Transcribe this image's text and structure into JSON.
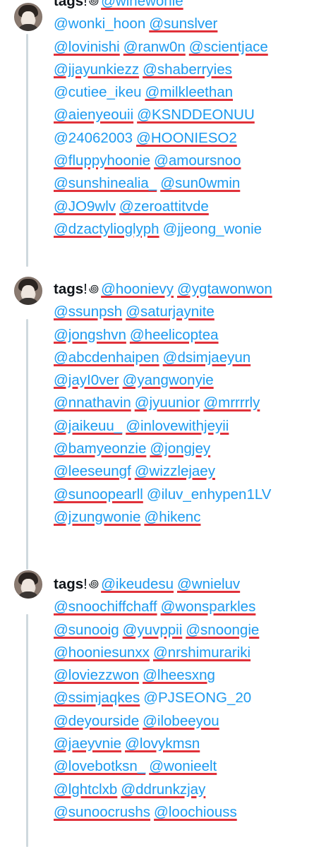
{
  "thread": [
    {
      "lead": "tags",
      "lead_excl": "!",
      "glyph": "꩜",
      "lines": [
        [
          {
            "text": "@winewonie",
            "u": true
          }
        ],
        [
          {
            "text": "@wonki_hoon",
            "u": false
          },
          {
            "text": "@sunslver",
            "u": true
          }
        ],
        [
          {
            "text": "@lovinishi",
            "u": true
          },
          {
            "text": "@ranw0n",
            "u": true
          },
          {
            "text": "@scientjace",
            "u": true
          }
        ],
        [
          {
            "text": "@jjayunkiezz",
            "u": true
          },
          {
            "text": "@shaberryies",
            "u": true
          }
        ],
        [
          {
            "text": "@cutiee_ikeu",
            "u": false
          },
          {
            "text": "@milkleethan",
            "u": true
          }
        ],
        [
          {
            "text": "@aienyeouii",
            "u": true
          },
          {
            "text": "@KSNDDEONUU",
            "u": true
          }
        ],
        [
          {
            "text": "@24062003",
            "u": false
          },
          {
            "text": "@HOONIESO2",
            "u": true
          }
        ],
        [
          {
            "text": "@fluppyhoonie",
            "u": true
          },
          {
            "text": "@amoursnoo",
            "u": true
          }
        ],
        [
          {
            "text": "@sunshinealia_",
            "u": true
          },
          {
            "text": "@sun0wmin",
            "u": true
          }
        ],
        [
          {
            "text": "@JO9wlv",
            "u": true
          },
          {
            "text": "@zeroattitvde",
            "u": true
          }
        ],
        [
          {
            "text": "@dzactylioglyph",
            "u": true
          },
          {
            "text": "@jjeong_wonie",
            "u": false
          }
        ]
      ]
    },
    {
      "lead": "tags",
      "lead_excl": "!",
      "glyph": "꩜",
      "lines": [
        [
          {
            "text": "@hoonievy",
            "u": true
          },
          {
            "text": "@ygtawonwon",
            "u": true
          }
        ],
        [
          {
            "text": "@ssunpsh",
            "u": true
          },
          {
            "text": "@saturjaynite",
            "u": true
          }
        ],
        [
          {
            "text": "@jongshvn",
            "u": true
          },
          {
            "text": "@heelicoptea",
            "u": true
          }
        ],
        [
          {
            "text": "@abcdenhaipen",
            "u": true
          },
          {
            "text": "@dsimjaeyun",
            "u": true
          }
        ],
        [
          {
            "text": "@jayI0ver",
            "u": true
          },
          {
            "text": "@yangwonyie",
            "u": true
          }
        ],
        [
          {
            "text": "@nnathavin",
            "u": true
          },
          {
            "text": "@jyuunior",
            "u": true
          },
          {
            "text": "@mrrrrly",
            "u": true
          }
        ],
        [
          {
            "text": "@jaikeuu_",
            "u": true
          },
          {
            "text": "@inlovewithjeyii",
            "u": true
          }
        ],
        [
          {
            "text": "@bamyeonzie",
            "u": true
          },
          {
            "text": "@jongjey",
            "u": true
          }
        ],
        [
          {
            "text": "@leeseungf",
            "u": true
          },
          {
            "text": "@wizzlejaey",
            "u": true
          }
        ],
        [
          {
            "text": "@sunoopearll",
            "u": true
          },
          {
            "text": "@iluv_enhypen1LV",
            "u": false
          }
        ],
        [
          {
            "text": "@jzungwonie",
            "u": true
          },
          {
            "text": "@hikenc",
            "u": true
          }
        ]
      ]
    },
    {
      "lead": "tags",
      "lead_excl": "!",
      "glyph": "꩜",
      "lines": [
        [
          {
            "text": "@ikeudesu",
            "u": true
          },
          {
            "text": "@wnieluv",
            "u": true
          }
        ],
        [
          {
            "text": "@snoochiffchaff",
            "u": true
          },
          {
            "text": "@wonsparkles",
            "u": true
          }
        ],
        [
          {
            "text": "@sunooig",
            "u": true
          },
          {
            "text": "@yuvppii",
            "u": true
          },
          {
            "text": "@snoongie",
            "u": true
          }
        ],
        [
          {
            "text": "@hooniesunxx",
            "u": true
          },
          {
            "text": "@nrshimurariki",
            "u": true
          }
        ],
        [
          {
            "text": "@loviezzwon",
            "u": true
          },
          {
            "text": "@lheesxng",
            "u": true
          }
        ],
        [
          {
            "text": "@ssimjaqkes",
            "u": true
          },
          {
            "text": "@PJSEONG_20",
            "u": false
          }
        ],
        [
          {
            "text": "@deyourside",
            "u": true
          },
          {
            "text": "@ilobeeyou",
            "u": true
          }
        ],
        [
          {
            "text": "@jaeyvnie",
            "u": true
          },
          {
            "text": "@lovykmsn",
            "u": true
          }
        ],
        [
          {
            "text": "@lovebotksn_",
            "u": true
          },
          {
            "text": "@wonieelt",
            "u": true
          }
        ],
        [
          {
            "text": "@lghtclxb",
            "u": true
          },
          {
            "text": "@ddrunkzjay",
            "u": true
          }
        ],
        [
          {
            "text": "@sunoocrushs",
            "u": true
          },
          {
            "text": "@loochiouss",
            "u": true
          }
        ]
      ]
    }
  ]
}
